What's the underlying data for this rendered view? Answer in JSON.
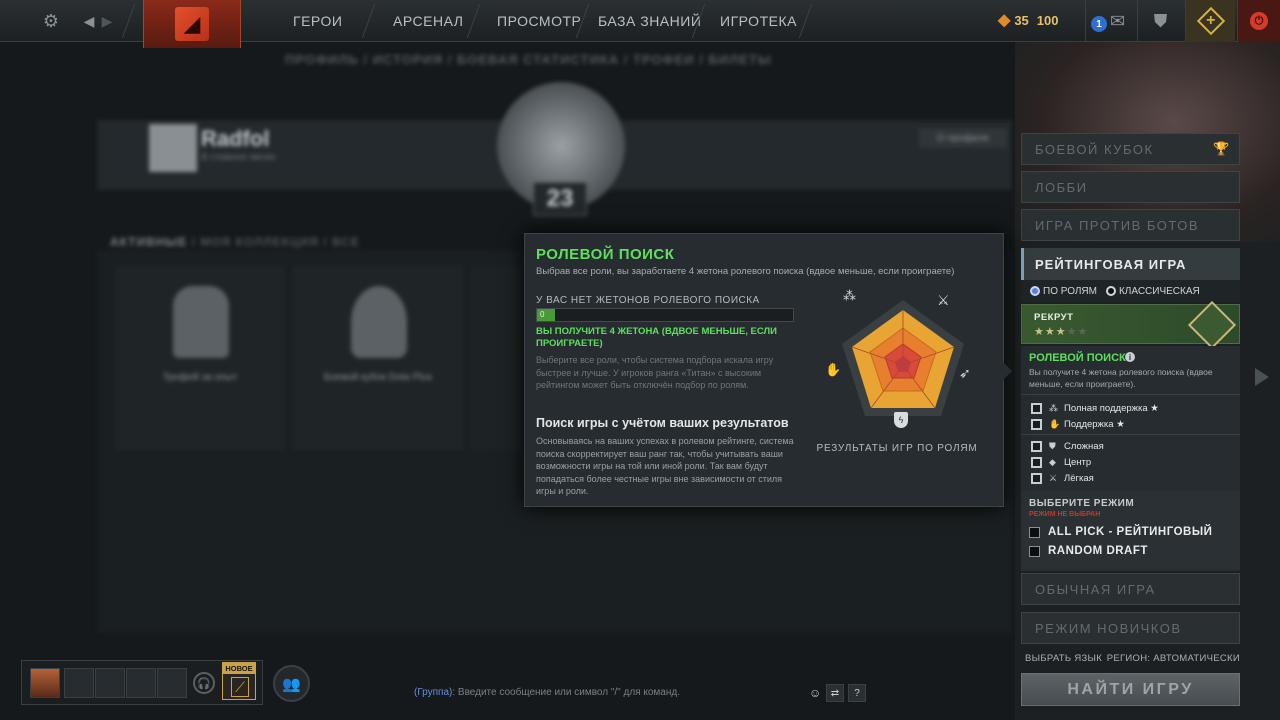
{
  "topbar": {
    "nav": [
      "ГЕРОИ",
      "АРСЕНАЛ",
      "ПРОСМОТР",
      "БАЗА ЗНАНИЙ",
      "ИГРОТЕКА"
    ],
    "shards": "35",
    "currency": "100",
    "notification_count": "1",
    "icons": [
      "gear-icon",
      "back-arrow-icon",
      "forward-arrow-icon",
      "dota-logo-icon",
      "shards-icon",
      "mail-icon",
      "armory-icon",
      "plus-icon",
      "power-icon"
    ]
  },
  "background": {
    "subnav": "ПРОФИЛЬ / ИСТОРИЯ / БОЕВАЯ СТАТИСТИКА / ТРОФЕИ / БИЛЕТЫ",
    "profile_name": "Radfol",
    "profile_sub": "В главное меню",
    "profile_button": "О профиле",
    "medal_number": "23",
    "filters": [
      "АКТИВНЫЕ",
      "МОЯ КОЛЛЕКЦИЯ",
      "ВСЕ"
    ],
    "trophies": [
      "Трофей за опыт",
      "Боевой кубок Dota Plus"
    ]
  },
  "popup": {
    "title": "РОЛЕВОЙ ПОИСК",
    "subtitle": "Выбрав все роли, вы заработаете 4 жетона ролевого поиска (вдвое меньше, если проиграете)",
    "tokens_heading": "У ВАС НЕТ ЖЕТОНОВ РОЛЕВОГО ПОИСКА",
    "tokens_count": "0",
    "tokens_progress": 0.07,
    "reward_text": "ВЫ ПОЛУЧИТЕ 4 ЖЕТОНА (ВДВОЕ МЕНЬШЕ, ЕСЛИ ПРОИГРАЕТЕ)",
    "hint": "Выберите все роли, чтобы система подбора искала игру быстрее и лучше. У игроков ранга «Титан» с высоким рейтингом может быть отключён подбор по ролям.",
    "heading2": "Поиск игры с учётом ваших результатов",
    "body": "Основываясь на ваших успехах в ролевом рейтинге, система поиска скорректирует ваш ранг так, чтобы учитывать ваши возможности игры на той или иной роли. Так вам будут попадаться более честные игры вне зависимости от стиля игры и роли.",
    "radar_label": "РЕЗУЛЬТАТЫ ИГР ПО РОЛЯМ",
    "radar_icons": [
      "hard-support-icon",
      "carry-sword-icon",
      "offlane-bow-icon",
      "mid-shield-icon",
      "support-hand-icon"
    ]
  },
  "sidebar": {
    "buttons": [
      "БОЕВОЙ КУБОК",
      "ЛОББИ",
      "ИГРА ПРОТИВ БОТОВ"
    ],
    "ranked_title": "РЕЙТИНГОВАЯ ИГРА",
    "queue_options": [
      "ПО РОЛЯМ",
      "КЛАССИЧЕСКАЯ"
    ],
    "rank_name": "РЕКРУТ",
    "rank_stars": "★★★",
    "rank_stars_empty": "★★",
    "role_search_title": "РОЛЕВОЙ ПОИСК",
    "role_search_desc": "Вы получите 4 жетона ролевого поиска (вдвое меньше, если проиграете).",
    "roles": [
      {
        "label": "Полная поддержка",
        "star": "★",
        "icon": "full-support-icon"
      },
      {
        "label": "Поддержка",
        "star": "★",
        "icon": "support-icon"
      },
      {
        "label": "Сложная",
        "star": "",
        "icon": "offlane-icon"
      },
      {
        "label": "Центр",
        "star": "",
        "icon": "mid-icon"
      },
      {
        "label": "Лёгкая",
        "star": "",
        "icon": "carry-icon"
      }
    ],
    "mode_heading": "ВЫБЕРИТЕ РЕЖИМ",
    "mode_warning": "РЕЖИМ НЕ ВЫБРАН",
    "modes": [
      "ALL PICK - РЕЙТИНГОВЫЙ",
      "RANDOM DRAFT"
    ],
    "other_buttons": [
      "ОБЫЧНАЯ ИГРА",
      "РЕЖИМ НОВИЧКОВ"
    ],
    "language": "ВЫБРАТЬ ЯЗЫК",
    "region": "РЕГИОН: АВТОМАТИЧЕСКИ",
    "find_button": "НАЙТИ ИГРУ"
  },
  "bottombar": {
    "new_badge": "НОВОЕ",
    "chat_channel": "(Группа):",
    "chat_placeholder": "Введите сообщение или символ \"/\" для команд.",
    "help": "?"
  }
}
